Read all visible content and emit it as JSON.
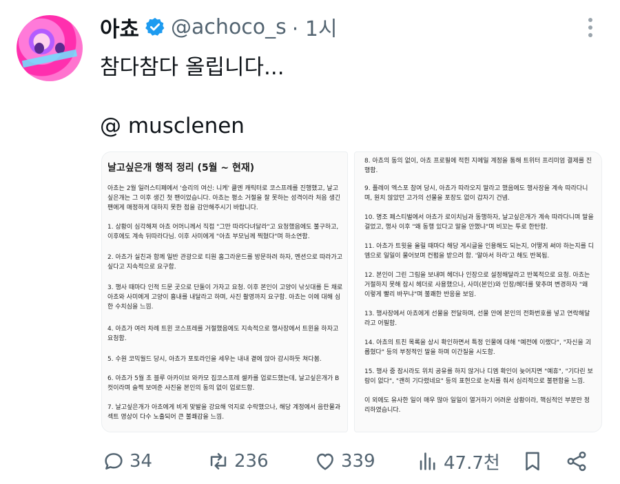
{
  "post": {
    "author_name": "아쵸",
    "handle": "@achoco_s",
    "time": "· 1시",
    "text_line1": "참다참다 올립니다...",
    "text_line2": "@ musclenen"
  },
  "left_card": {
    "title": "날고싶은개 행적 정리 (5월 ~ 현재)",
    "paragraphs": [
      "아쵸는 2월 일러스티페에서 '승리의 여신: 니케' 클엔 캐릭터로 코스프레를 진행했고, 날고싶은개는 그 이후 생긴 첫 팬이었습니다. 아쵸는 평소 거절을 잘 못하는 성격이라 처음 생긴 팬에게 매정하게 대하지 못한 점을 감안해주시기 바랍니다.",
      "1. 상황이 심각해져 아쵸 어머니께서 직접 \"그만 따라다녀달라\"고 요청했음에도 불구하고, 이후에도 계속 뒤따라다님. 이후 사미에게 \"아쵸 부모님께 찍혔다\"며 하소연함.",
      "2. 아쵸가 실친과 함께 일반 관광으로 티원 홈그라운드를 방문하려 하자, 멘션으로 따라가고 싶다고 지속적으로 요구함.",
      "3. 행사 때마다 인적 드문 곳으로 단둘이 가자고 요청. 이후 본인이 고양이 낚싯대를 든 채로 아쵸와 사미에게 고양이 흉내를 내달라고 하며, 사진 촬영까지 요구함. 아쵸는 이에 대해 심한 수치심을 느낌.",
      "4. 아쵸가 여러 차례 트윈 코스프레를 거절했음에도 지속적으로 행사장에서 트윈을 하자고 요청함.",
      "5. 수원 코믹월드 당시, 아쵸가 포토라인을 세우는 내내 곁에 앉아 감시하듯 쳐다봄.",
      "6. 아쵸가 5월 초 블루 아카이브 와카모 집코스프레 셀카를 업로드했는데, 날고싶은개가 B컷이라며 슬쩍 보여준 사진을 본인의 동의 없이 업로드함.",
      "7. 날고싶은개가 아쵸에게 비게 맞발을 강요해 억지로 수락했으나, 해당 계정에서 음란물과 섹트 영상이 다수 노출되어 큰 불쾌감을 느낌."
    ]
  },
  "right_card": {
    "paragraphs": [
      "8. 아쵸의 동의 없이, 아쵸 프로필에 적힌 지메일 계정을 통해 트위터 프리미엄 결제를 진행함.",
      "9. 플레이 엑스포 참여 당시, 아쵸가 따라오지 말라고 했음에도 행사장을 계속 따라다니며, 원치 않았던 고가의 선물을 포장도 없이 갑자기 건넴.",
      "10. 명조 페스티벌에서 아쵸가 로이치님과 동행하자, 날고싶은개가 계속 따라다니며 말을 걸었고, 행사 이후 \"왜 동행 있다고 말을 안했냐\"며 비꼬는 투로 한탄함.",
      "11. 아쵸가 트윗을 올릴 때마다 해당 게시글을 인용해도 되는지, 어떻게 써야 하는지를 디엠으로 일일이 물어보며 컨펌을 받으려 함. '알아서 하라'고 해도 반복됨.",
      "12. 본인이 그린 그림을 보내며 헤더나 인장으로 설정해달라고 반복적으로 요청. 아쵸는 거절하지 못해 잠시 헤더로 사용했으나, 사미(본인)와 인장/헤더를 맞추며 변경하자 \"왜 이렇게 빨리 바꾸냐\"며 불쾌한 반응을 보임.",
      "13. 행사장에서 아쵸에게 선물을 전달하며, 선물 안에 본인의 전화번호를 넣고 연락해달라고 어필함.",
      "14. 아쵸의 트친 목록을 상시 확인하면서 특정 인물에 대해 \"예전에 이랬다\", \"자신을 괴롭혔다\" 등의 부정적인 말을 하며 이간질을 시도함.",
      "15. 행사 중 잠시라도 위치 공유를 하지 않거나 디엠 확인이 늦어지면 \"예휴\", \"기다린 보람이 없다\", \"괜히 기다렸네요\" 등의 표현으로 눈치를 줘서 심리적으로 불편함을 느낌.",
      "이 외에도 유사한 일이 매우 많아 일일이 열거하기 어려운 상황이라, 핵심적인 부분만 정리하였습니다."
    ]
  },
  "actions": {
    "replies": "34",
    "retweets": "236",
    "likes": "339",
    "views": "47.7천"
  },
  "colors": {
    "verified": "#1d9bf0",
    "muted": "#536471"
  }
}
